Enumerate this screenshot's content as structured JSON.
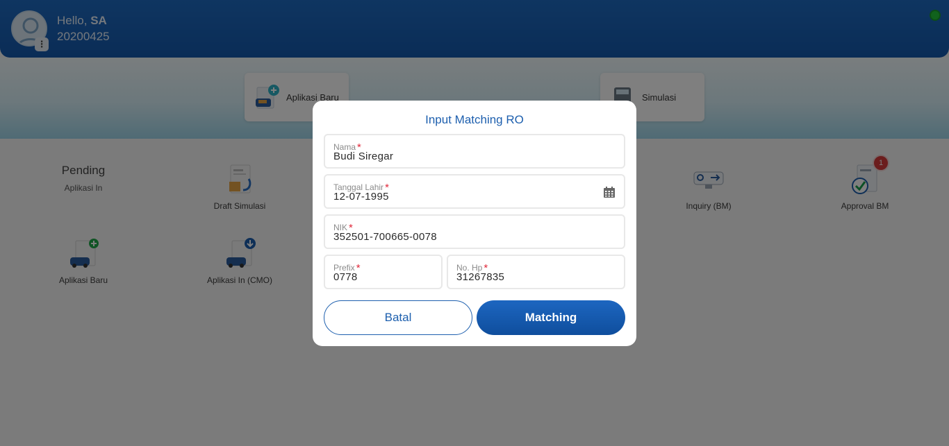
{
  "header": {
    "greeting": "Hello,",
    "user_name": "SA",
    "user_id": "20200425",
    "status_color": "#22c43b"
  },
  "quick_actions": [
    {
      "label": "Aplikasi Baru",
      "icon": "new-application-icon"
    },
    {
      "label": "Simulasi",
      "icon": "calculator-icon"
    }
  ],
  "menu": {
    "pending_title": "Pending",
    "pending_sub": "Aplikasi In",
    "draft_simulasi": "Draft Simulasi",
    "inquiry_bm": "Inquiry (BM)",
    "approval_bm": "Approval BM",
    "approval_badge": "1",
    "aplikasi_baru": "Aplikasi Baru",
    "aplikasi_in_cmo": "Aplikasi In (CMO)"
  },
  "modal": {
    "title": "Input Matching RO",
    "nama": {
      "label": "Nama",
      "value": "Budi Siregar"
    },
    "tanggal_lahir": {
      "label": "Tanggal Lahir",
      "value": "12-07-1995"
    },
    "nik": {
      "label": "NIK",
      "value": "352501-700665-0078"
    },
    "prefix": {
      "label": "Prefix",
      "value": "0778"
    },
    "no_hp": {
      "label": "No. Hp",
      "value": "31267835"
    },
    "required_mark": "*",
    "cancel_label": "Batal",
    "submit_label": "Matching"
  },
  "colors": {
    "primary": "#1d5fae",
    "required": "#e0283a",
    "badge": "#d63a3a"
  }
}
